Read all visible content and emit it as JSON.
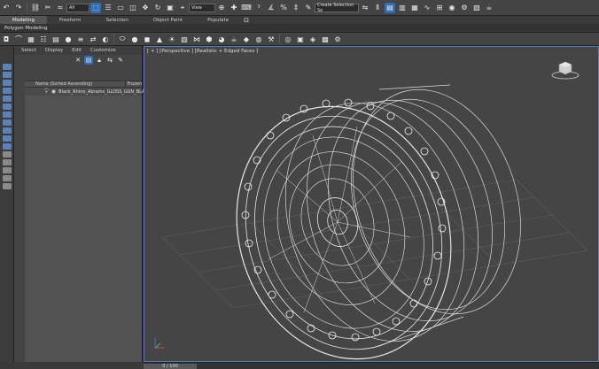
{
  "toolbar": {
    "selection_filter": "All",
    "ref_coord": "View",
    "named_selection_placeholder": "Create Selection Se"
  },
  "ribbon": {
    "tabs": [
      "Modeling",
      "Freeform",
      "Selection",
      "Object Paint",
      "Populate"
    ],
    "sub_label": "Polygon Modeling"
  },
  "explorer": {
    "menu": [
      "Select",
      "Display",
      "Edit",
      "Customize"
    ],
    "columns": {
      "name": "Name (Sorted Ascending)",
      "frozen": "Frozen"
    },
    "rows": [
      {
        "name": "Black_Rhino_Abrams_GLOSS_GUN_BLACK"
      }
    ]
  },
  "viewport": {
    "label": "[ + ] [Perspective ] [Realistic + Edged Faces ]"
  },
  "timeline": {
    "frame": "0 / 100"
  }
}
